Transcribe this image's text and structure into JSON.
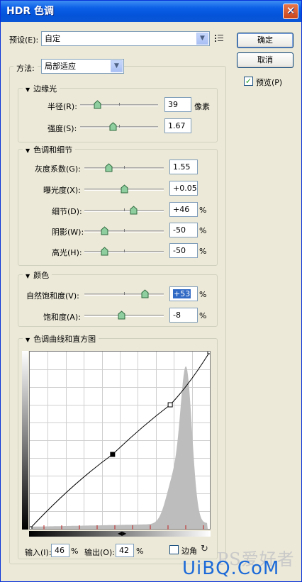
{
  "window": {
    "title": "HDR 色调",
    "close_glyph": "✕"
  },
  "preset": {
    "label": "预设(E):",
    "value": "自定",
    "menu_icon": "list-menu-icon"
  },
  "buttons": {
    "ok": "确定",
    "cancel": "取消"
  },
  "preview": {
    "label": "预览(P)",
    "checked": true
  },
  "method": {
    "label": "方法:",
    "value": "局部适应"
  },
  "sections": {
    "edge_glow": "边缘光",
    "tone_detail": "色调和细节",
    "color": "颜色",
    "curve": "色调曲线和直方图"
  },
  "sliders": {
    "radius": {
      "label": "半径(R):",
      "value": "39",
      "unit": "像素",
      "pos": 0.22
    },
    "strength": {
      "label": "强度(S):",
      "value": "1.67",
      "unit": "",
      "pos": 0.42
    },
    "gamma": {
      "label": "灰度系数(G):",
      "value": "1.55",
      "unit": "",
      "pos": 0.3
    },
    "exposure": {
      "label": "曝光度(X):",
      "value": "+0.05",
      "unit": "",
      "pos": 0.5
    },
    "detail": {
      "label": "细节(D):",
      "value": "+46",
      "unit": "%",
      "pos": 0.62
    },
    "shadow": {
      "label": "阴影(W):",
      "value": "-50",
      "unit": "%",
      "pos": 0.25
    },
    "highlight": {
      "label": "高光(H):",
      "value": "-50",
      "unit": "%",
      "pos": 0.25
    },
    "vibrance": {
      "label": "自然饱和度(V):",
      "value": "+53",
      "unit": "%",
      "pos": 0.76
    },
    "saturation": {
      "label": "饱和度(A):",
      "value": "-8",
      "unit": "%",
      "pos": 0.46
    }
  },
  "curve": {
    "input_label": "输入(I):",
    "input_value": "46",
    "input_unit": "%",
    "output_label": "输出(O):",
    "output_value": "42",
    "output_unit": "%",
    "corner_label": "边角",
    "corner_checked": false,
    "points": [
      [
        0,
        0
      ],
      [
        46,
        42
      ],
      [
        78,
        70
      ],
      [
        100,
        100
      ]
    ]
  },
  "watermark": {
    "text1": "PS爱好者",
    "text2": "UiBQ.CoM"
  }
}
